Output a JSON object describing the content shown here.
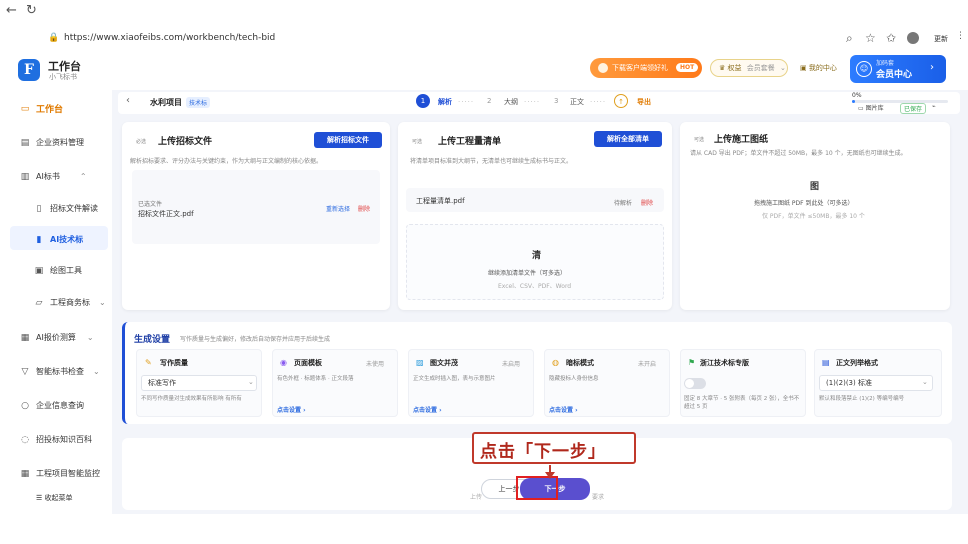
{
  "browser": {
    "url": "https://www.xiaofeibs.com/workbench/tech-bid",
    "profile_label": "更新"
  },
  "header": {
    "app_title": "工作台",
    "app_subtitle": "小飞标书",
    "promo_label": "下载客户端领好礼",
    "hot_badge": "HOT",
    "perm_label": "权益",
    "perm_value": "会员套餐",
    "balance_label": "我的中心",
    "member_small": "加码套",
    "member_big": "会员中心"
  },
  "sidebar": {
    "items": [
      {
        "label": "工作台",
        "icon": "monitor-icon"
      },
      {
        "label": "企业资料管理",
        "icon": "briefcase-icon"
      },
      {
        "label": "AI标书",
        "icon": "document-icon"
      },
      {
        "label": "招标文件解读",
        "icon": "book-icon"
      },
      {
        "label": "AI技术标",
        "icon": "file-icon"
      },
      {
        "label": "绘图工具",
        "icon": "image-icon"
      },
      {
        "label": "工程商务标",
        "icon": "folder-icon"
      },
      {
        "label": "AI报价测算",
        "icon": "calculator-icon"
      },
      {
        "label": "智能标书检查",
        "icon": "filter-icon"
      },
      {
        "label": "企业信息查询",
        "icon": "search-icon"
      },
      {
        "label": "招投标知识百科",
        "icon": "chat-icon"
      },
      {
        "label": "工程项目智能监控",
        "icon": "calendar-icon"
      }
    ],
    "collapse_label": "收起菜单"
  },
  "topbar": {
    "project_title": "水利项目",
    "project_tag": "技术标",
    "steps": [
      {
        "num": "1",
        "label": "解析"
      },
      {
        "num": "2",
        "label": "大纲"
      },
      {
        "num": "3",
        "label": "正文"
      },
      {
        "num": "↑",
        "label": "导出"
      }
    ],
    "progress_text": "0%",
    "progress_value": 0.03,
    "link_gallery": "图片库",
    "link_saved": "已保存"
  },
  "cards": {
    "bid": {
      "tag": "必选",
      "title": "上传招标文件",
      "button": "解析招标文件",
      "desc": "解析招标要求、评分办法与关键约束，作为大纲与正文编制的核心依据。",
      "file_tag": "已选文件",
      "file_name": "招标文件正文.pdf",
      "reselect": "重新选择",
      "delete": "删除"
    },
    "list": {
      "tag": "可选",
      "title": "上传工程量清单",
      "button": "解析全部清单",
      "desc": "将清单项目标准到大纲节，无清单也可继续生成标书与正文。",
      "file_name": "工程量清单.pdf",
      "parse_state": "待解析",
      "delete": "删除",
      "upload_icon": "清",
      "upload_hint": "继续添加清单文件（可多选）",
      "upload_formats": "Excel、CSV、PDF、Word"
    },
    "drawing": {
      "tag": "可选",
      "title": "上传施工图纸",
      "desc": "请从 CAD 导出 PDF；单文件不超过 50MB，最多 10 个，无图纸也可继续生成。",
      "upload_icon": "图",
      "upload_hint": "拖拽施工图纸 PDF 到此处（可多选）",
      "upload_formats": "仅 PDF，单文件 ≤50MB，最多 10 个"
    }
  },
  "settings": {
    "title": "生成设置",
    "desc": "写作质量与生成偏好，修改后自动保存并应用于后续生成",
    "options": [
      {
        "icon": "pen-icon",
        "title": "写作质量",
        "state": "",
        "select": "标准写作",
        "desc": "不同写作质量对生成效果有所影响 有所有",
        "link": ""
      },
      {
        "icon": "layout-icon",
        "title": "页面模板",
        "state": "未使用",
        "desc": "有色外框 · 标题体系 · 正文段落",
        "link": "点击设置"
      },
      {
        "icon": "image-text-icon",
        "title": "图文并茂",
        "state": "未启用",
        "desc": "正文生成时插入图，表与示意图片",
        "link": "点击设置"
      },
      {
        "icon": "bulb-icon",
        "title": "暗标模式",
        "state": "未开启",
        "desc": "隐藏投标人身份信息",
        "link": "点击设置"
      },
      {
        "icon": "flag-icon",
        "title": "浙江技术标专版",
        "state": "",
        "desc": "固定 8 大章节 · 5 张附表（每页 2 张），全书不超过 5 页",
        "link": ""
      },
      {
        "icon": "list-icon",
        "title": "正文列举格式",
        "state": "",
        "select": "(1)(2)(3) 标准",
        "desc": "默认和段落禁止 (1)(2) 等编号编号",
        "link": ""
      }
    ]
  },
  "footer": {
    "callout": "点击「下一步」",
    "prev_label": "上一步",
    "next_label": "下一步",
    "left_hint": "上传",
    "right_hint": "要求"
  }
}
